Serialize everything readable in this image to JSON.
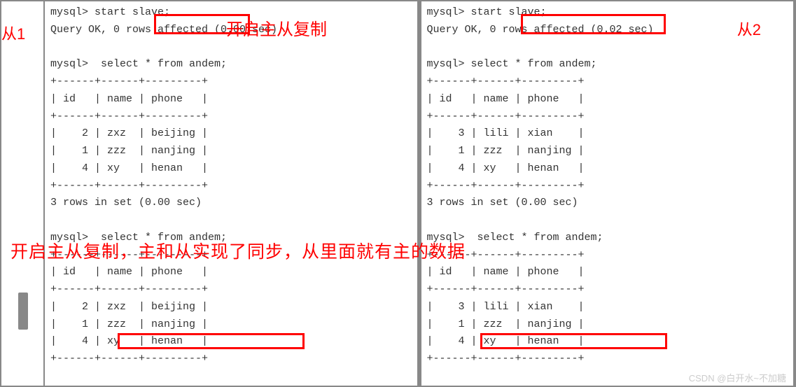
{
  "labels": {
    "cong1": "从1",
    "cong2": "从2",
    "header": "开启主从复制",
    "middle": "开启主从复制，主和从实现了同步，从里面就有主的数据"
  },
  "left_pane": {
    "cmd1": "mysql> start slave;",
    "resp1": "Query OK, 0 rows affected (0.00 sec)",
    "cmd2": "mysql>  select * from andem;",
    "border": "+------+------+---------+",
    "header_row": "| id   | name | phone   |",
    "rows1": [
      "|    2 | zxz  | beijing |",
      "|    1 | zzz  | nanjing |",
      "|    4 | xy   | henan   |"
    ],
    "resp2": "3 rows in set (0.00 sec)",
    "cmd3": "mysql>  select * from andem;",
    "rows2": [
      "|    2 | zxz  | beijing |",
      "|    1 | zzz  | nanjing |",
      "|    4 | xy   | henan   |"
    ]
  },
  "right_pane": {
    "cmd1": "mysql> start slave;",
    "resp1": "Query OK, 0 rows affected (0.02 sec)",
    "cmd2": "mysql> select * from andem;",
    "border": "+------+------+---------+",
    "header_row": "| id   | name | phone   |",
    "rows1": [
      "|    3 | lili | xian    |",
      "|    1 | zzz  | nanjing |",
      "|    4 | xy   | henan   |"
    ],
    "resp2": "3 rows in set (0.00 sec)",
    "cmd3": "mysql>  select * from andem;",
    "rows2": [
      "|    3 | lili | xian    |",
      "|    1 | zzz  | nanjing |",
      "|    4 | xy   | henan   |"
    ]
  },
  "watermark": "CSDN @白开水~不加糖"
}
